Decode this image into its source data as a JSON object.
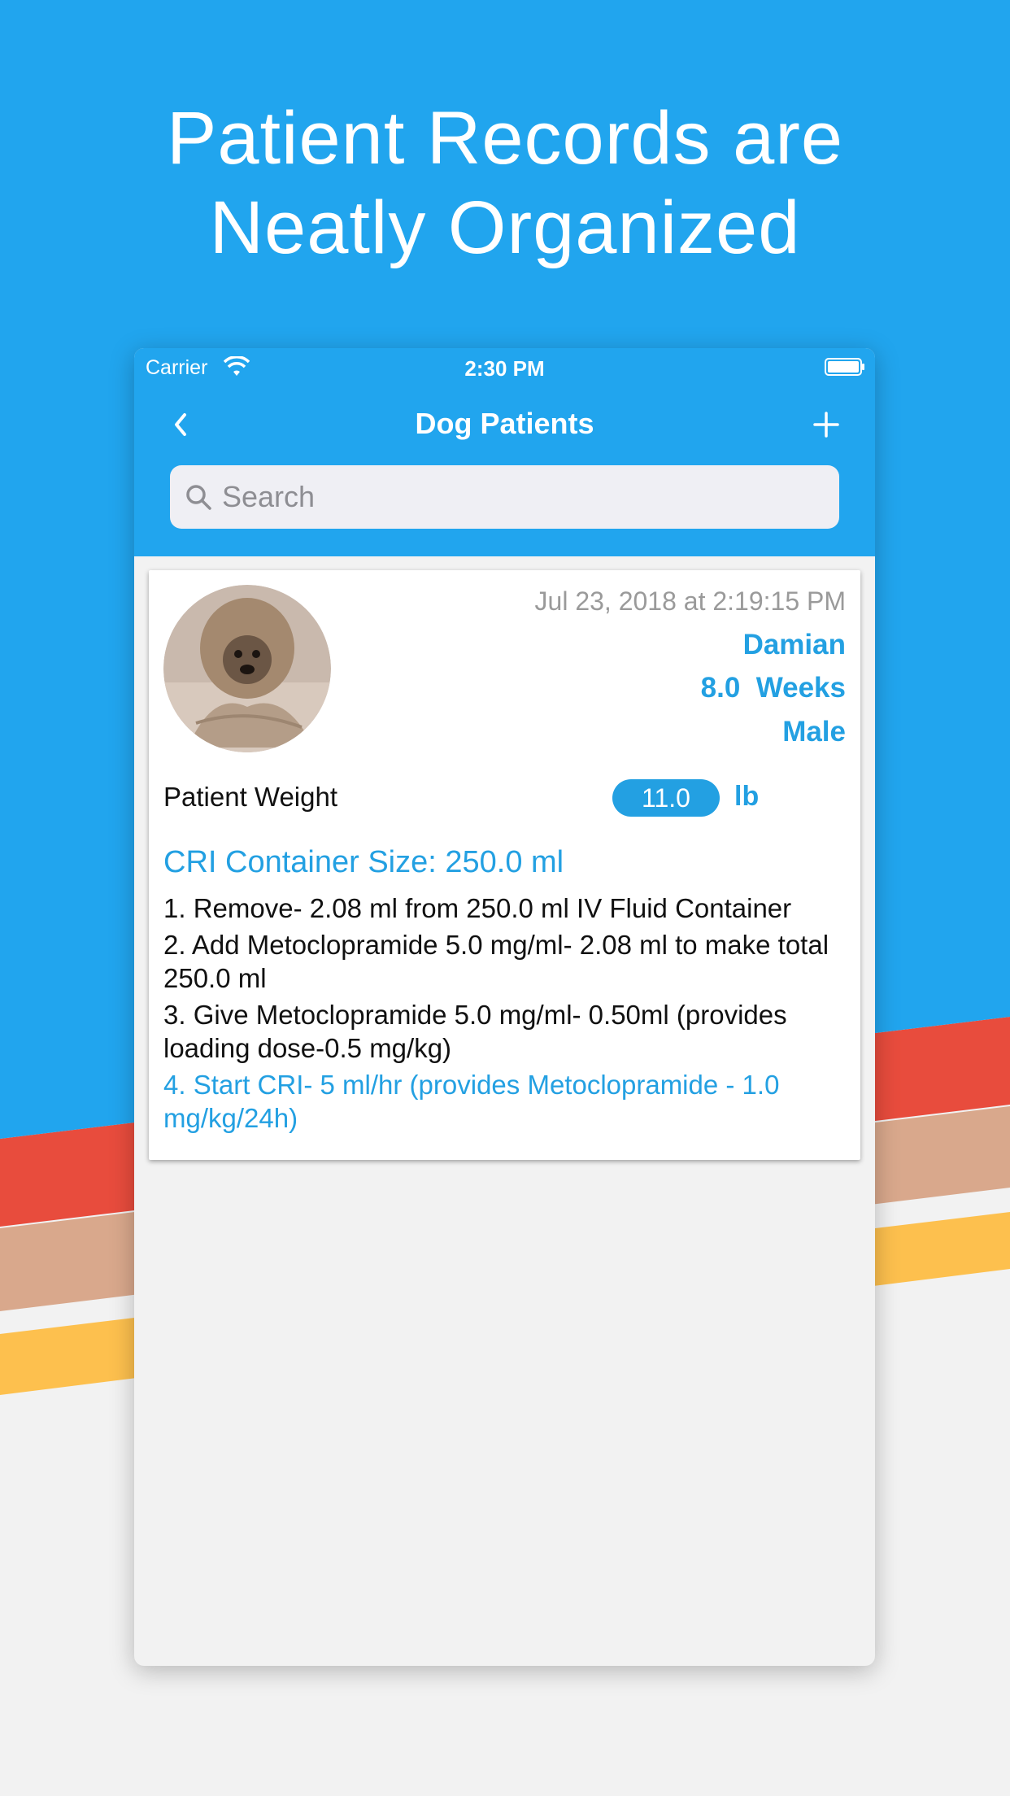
{
  "headline": {
    "line1": "Patient Records are",
    "line2": "Neatly Organized"
  },
  "colors": {
    "primary_blue": "#21a5ee",
    "stripe_red": "#e84c3d",
    "stripe_tan": "#d9a88c",
    "stripe_yellow": "#fdc04e",
    "background_gray": "#f2f2f2",
    "accent_text": "#23a0e2"
  },
  "status_bar": {
    "carrier": "Carrier",
    "time": "2:30 PM",
    "wifi_icon": "wifi-icon",
    "battery_icon": "battery-icon"
  },
  "navbar": {
    "title": "Dog Patients",
    "back_icon": "chevron-left-icon",
    "add_icon": "plus-icon"
  },
  "search": {
    "placeholder": "Search",
    "icon": "search-icon"
  },
  "patient_card": {
    "timestamp": "Jul 23, 2018 at 2:19:15 PM",
    "name": "Damian",
    "age": "8.0  Weeks",
    "sex": "Male",
    "weight_label": "Patient Weight",
    "weight_value": "11.0",
    "weight_unit": "lb",
    "cri_title": "CRI Container Size: 250.0 ml",
    "steps": [
      "1. Remove- 2.08 ml from 250.0 ml IV Fluid Container",
      "2. Add Metoclopramide 5.0 mg/ml- 2.08 ml to make total 250.0 ml",
      "3. Give Metoclopramide 5.0 mg/ml- 0.50ml (provides loading dose-0.5 mg/kg)",
      "4. Start CRI- 5 ml/hr (provides Metoclopramide - 1.0 mg/kg/24h)"
    ]
  }
}
